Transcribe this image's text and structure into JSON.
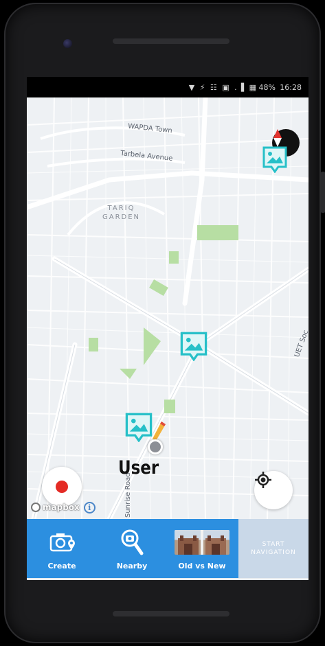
{
  "status_bar": {
    "icons": "▼ ⚡ ☷ ▣ .▐ ▦",
    "battery": "48%",
    "time": "16:28"
  },
  "map": {
    "streets": {
      "wapda_town": "WAPDA Town",
      "tarbela_avenue": "Tarbela Avenue",
      "sunrise_road": "Sunrise Road",
      "uet_partial": "UET Soc"
    },
    "area_label_line1": "TARIQ",
    "area_label_line2": "GARDEN",
    "user_label": "User",
    "attribution_brand": "mapbox",
    "info_glyph": "i"
  },
  "bottom_bar": {
    "tabs": [
      {
        "label": "Create",
        "icon": "camera-pin-icon"
      },
      {
        "label": "Nearby",
        "icon": "search-camera-icon"
      },
      {
        "label": "Old vs New",
        "icon": "old-new-thumbnail"
      }
    ],
    "start_navigation_line1": "START",
    "start_navigation_line2": "NAVIGATION"
  },
  "colors": {
    "accent": "#2c8fe0",
    "pin": "#26c0c8",
    "record": "#e42b25",
    "map_bg": "#eef1f4",
    "park": "#b7dea3"
  }
}
